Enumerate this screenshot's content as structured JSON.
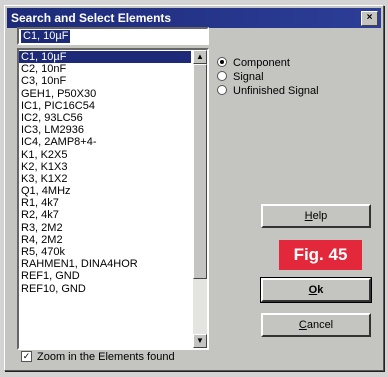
{
  "window": {
    "title": "Search and Select Elements",
    "close_glyph": "×"
  },
  "selection_field": {
    "value": "C1, 10µF"
  },
  "elements": [
    "C1, 10µF",
    "C2, 10nF",
    "C3, 10nF",
    "GEH1, P50X30",
    "IC1, PIC16C54",
    "IC2, 93LC56",
    "IC3, LM2936",
    "IC4, 2AMP8+4-",
    "K1, K2X5",
    "K2, K1X3",
    "K3, K1X2",
    "Q1, 4MHz",
    "R1, 4k7",
    "R2, 4k7",
    "R3, 2M2",
    "R4, 2M2",
    "R5, 470k",
    "RAHMEN1, DINA4HOR",
    "REF1, GND",
    "REF10, GND"
  ],
  "selected_index": 0,
  "search_type": {
    "options": [
      "Component",
      "Signal",
      "Unfinished Signal"
    ],
    "selected": "Component"
  },
  "buttons": {
    "help": {
      "prefix": "",
      "accel": "H",
      "rest": "elp"
    },
    "ok": {
      "prefix": "",
      "accel": "O",
      "rest": "k"
    },
    "cancel": {
      "prefix": "",
      "accel": "C",
      "rest": "ancel"
    }
  },
  "figure_badge": "Fig. 45",
  "zoom_checkbox": {
    "label": "Zoom in the Elements found",
    "checked": true,
    "check_glyph": "✓"
  },
  "scrollbar": {
    "up_glyph": "▲",
    "down_glyph": "▼"
  },
  "colors": {
    "titlebar": "#1c2a78",
    "selection": "#1c2a78",
    "badge": "#e2283a"
  }
}
